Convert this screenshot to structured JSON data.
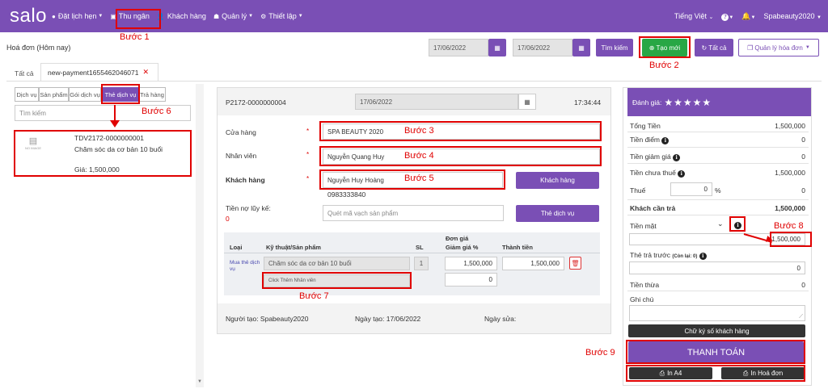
{
  "nav": {
    "logo": "salo",
    "items": [
      {
        "icon": "clock-icon",
        "label": "Đặt lịch hẹn",
        "caret": true
      },
      {
        "icon": "cashier-icon",
        "label": "Thu ngân",
        "caret": false
      },
      {
        "icon": "user-icon",
        "label": "Khách hàng",
        "caret": false
      },
      {
        "icon": "users-icon",
        "label": "Quản lý",
        "caret": true
      },
      {
        "icon": "cog-icon",
        "label": "Thiết lập",
        "caret": true
      }
    ],
    "language": "Tiếng Việt",
    "help": "?",
    "user": "Spabeauty2020"
  },
  "page": {
    "title": "Hoá đơn (Hôm nay)",
    "date_from": "17/06/2022",
    "date_to": "17/06/2022",
    "search_label": "Tìm kiếm",
    "create_label": "Tạo mới",
    "all_label": "Tất cả",
    "manage_label": "Quản lý hóa đơn"
  },
  "tabs": {
    "all": "Tất cả",
    "current": "new-payment1655462046071",
    "close": "✕"
  },
  "left": {
    "cats": [
      "Dịch vụ",
      "Sản phẩm",
      "Gói dịch vụ",
      "Thẻ dịch vụ",
      "Trả hàng"
    ],
    "search_placeholder": "Tìm kiếm",
    "card": {
      "code": "TDV2172-0000000001",
      "name": "Chăm sóc da cơ bản 10 buổi",
      "price": "Giá: 1,500,000",
      "noimage": "NO IMAGE"
    }
  },
  "invoice": {
    "code": "P2172-0000000004",
    "date": "17/06/2022",
    "time": "17:34:44",
    "store_label": "Cửa hàng",
    "store": "SPA BEAUTY 2020",
    "staff_label": "Nhân viên",
    "staff": "Nguyễn Quang Huy",
    "customer_label": "Khách hàng",
    "customer": "Nguyễn Huy Hoàng",
    "phone": "0983333840",
    "customer_btn": "Khách hàng",
    "debt_label": "Tiền nợ lũy kế:",
    "debt": "0",
    "barcode_placeholder": "Quét mã vạch sản phẩm",
    "card_btn": "Thẻ dịch vụ",
    "required": "*",
    "cols": {
      "type": "Loại",
      "product": "Kỹ thuật/Sản phẩm",
      "qty": "SL",
      "price": "Đơn giá",
      "discount": "Giảm giá %",
      "total": "Thành tiền"
    },
    "row": {
      "type": "Mua thẻ dịch vụ",
      "product": "Chăm sóc da cơ bản 10 buổi",
      "qty": "1",
      "price": "1,500,000",
      "discount": "0",
      "total": "1,500,000",
      "add_staff": "Click Thêm Nhân viên"
    },
    "creator": "Người tạo: Spabeauty2020",
    "created": "Ngày tạo: 17/06/2022",
    "modified": "Ngày sửa:"
  },
  "summary": {
    "rating_label": "Đánh giá:",
    "stars": "★★★★★",
    "total_label": "Tổng Tiền",
    "total": "1,500,000",
    "points_label": "Tiền điểm",
    "points": "0",
    "discount_label": "Tiền giảm giá",
    "discount": "0",
    "pretax_label": "Tiền chưa thuế",
    "pretax": "1,500,000",
    "tax_label": "Thuế",
    "tax_input": "0",
    "tax_pct": "%",
    "tax": "0",
    "due_label": "Khách cần trả",
    "due": "1,500,000",
    "cash_label": "Tiền mặt",
    "cash": "1,500,000",
    "prepaid_label": "Thẻ trả trước",
    "prepaid_note": "(Còn lại: 0)",
    "prepaid": "0",
    "change_label": "Tiền thừa",
    "change": "0",
    "note_label": "Ghi chú",
    "signature": "Chữ ký số khách hàng",
    "pay": "THANH TOÁN",
    "print_a4": "In A4",
    "print_invoice": "In Hoá đơn"
  },
  "steps": [
    "Bước 1",
    "Bước 2",
    "Bước 3",
    "Bước 4",
    "Bước 5",
    "Bước 6",
    "Bước 7",
    "Bước 8",
    "Bước 9"
  ]
}
